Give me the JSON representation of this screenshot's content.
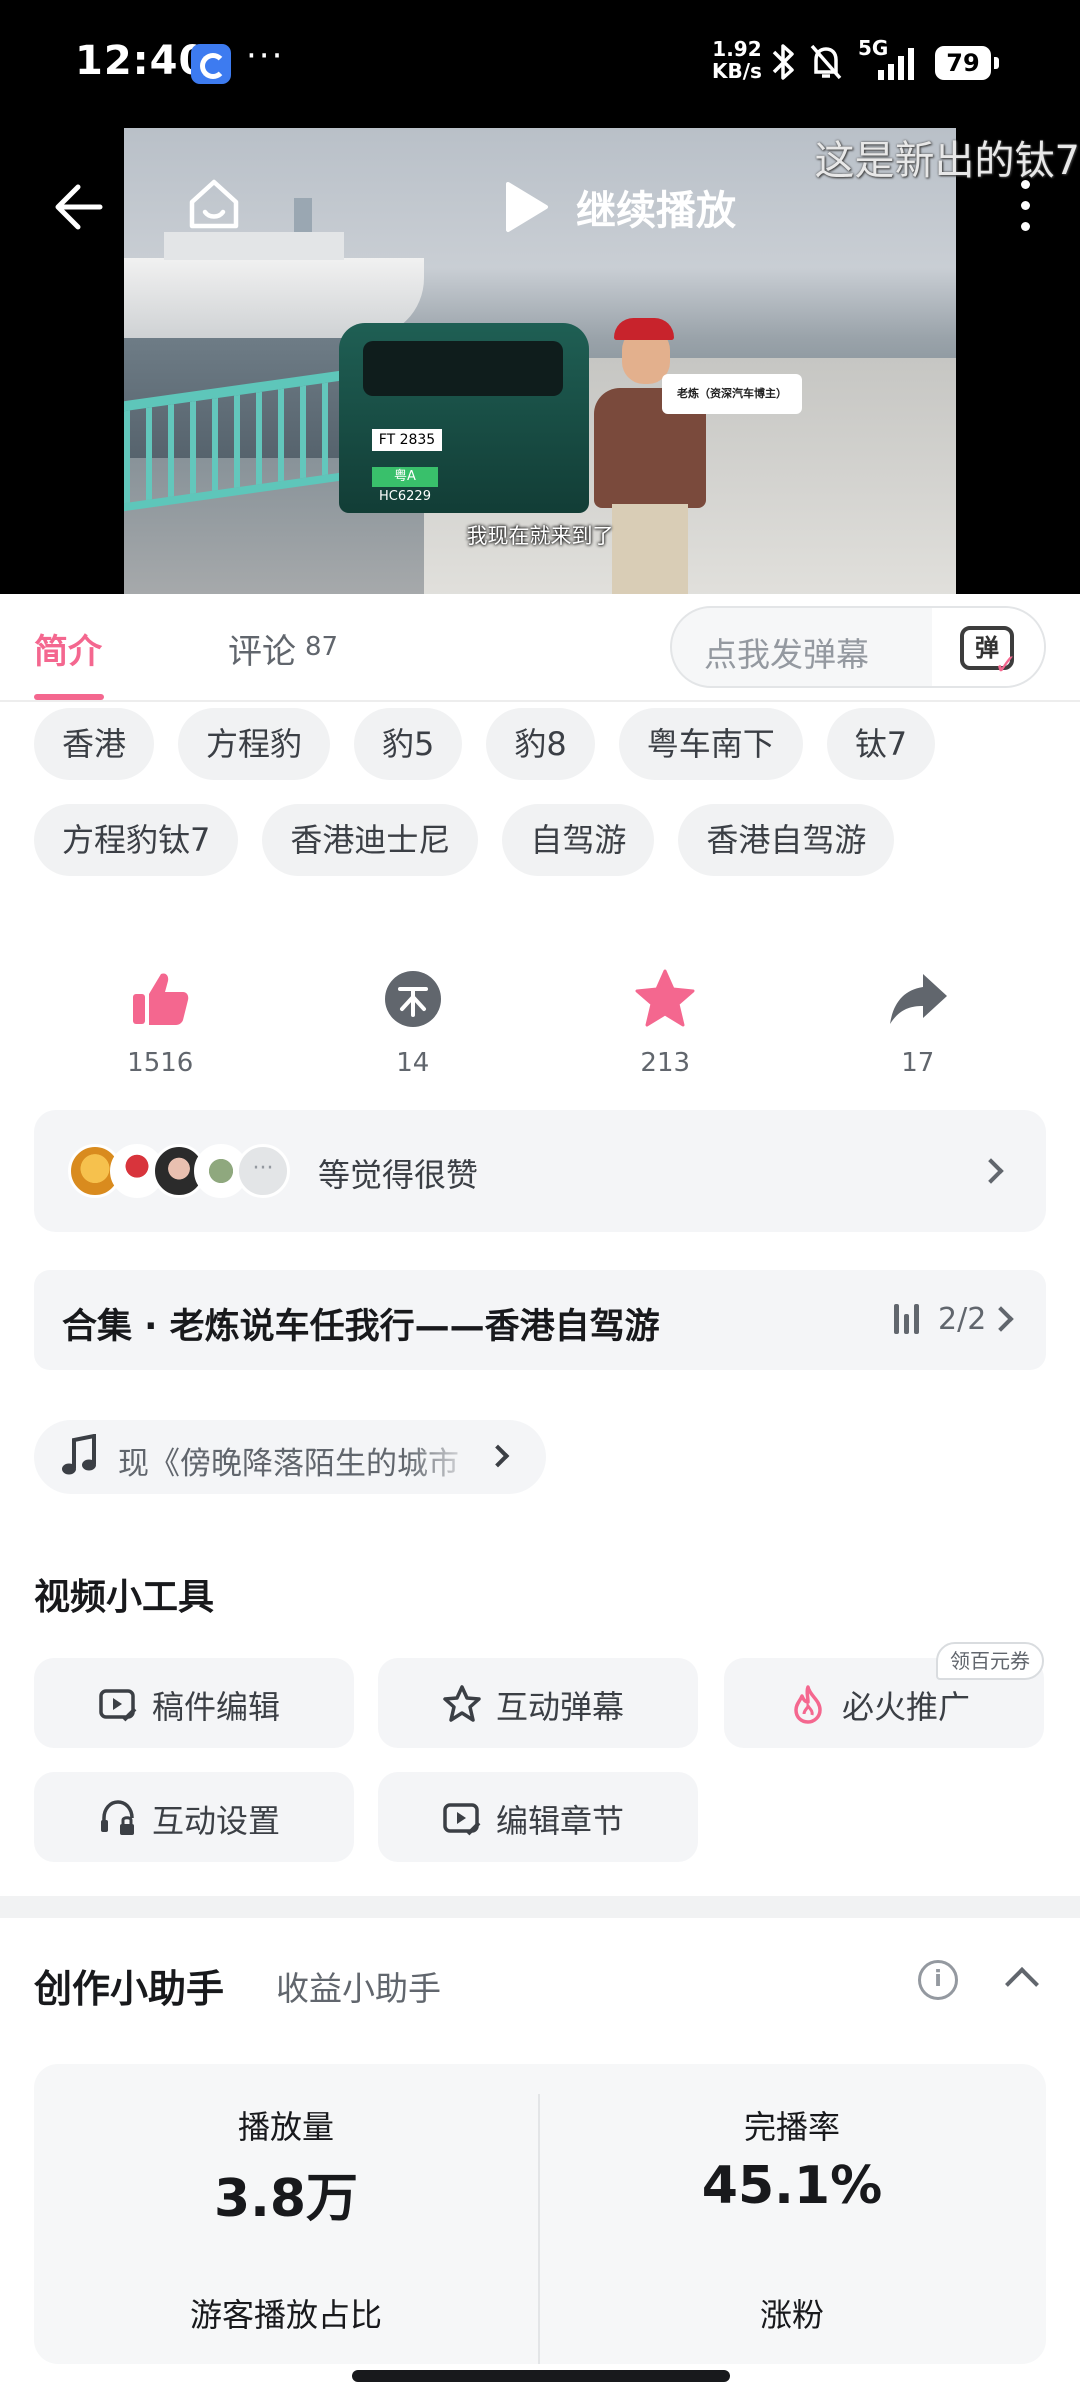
{
  "status_bar": {
    "time": "12:40",
    "more": "···",
    "speed_value": "1.92",
    "speed_unit": "KB/s",
    "network": "5G",
    "battery": "79"
  },
  "video": {
    "resume_label": "继续播放",
    "danmaku": "这是新出的钛7",
    "subtitle": "我现在就来到了",
    "name_card": "老炼（资深汽车博主）",
    "plate_front": "FT 2835",
    "plate_green": "粤A HC6229"
  },
  "tabs": {
    "intro": "简介",
    "comments": "评论",
    "comments_count": "87",
    "danmaku_placeholder": "点我发弹幕",
    "danmaku_button": "弹"
  },
  "tags": [
    "香港",
    "方程豹",
    "豹5",
    "豹8",
    "粤车南下",
    "钛7",
    "方程豹钛7",
    "香港迪士尼",
    "自驾游",
    "香港自驾游"
  ],
  "actions": [
    {
      "icon": "thumbs-up-icon",
      "count": "1516",
      "color": "#f4678f"
    },
    {
      "icon": "coin-icon",
      "count": "14",
      "color": "#61666d"
    },
    {
      "icon": "star-icon",
      "count": "213",
      "color": "#f4678f"
    },
    {
      "icon": "share-icon",
      "count": "17",
      "color": "#61666d"
    }
  ],
  "liked_by": {
    "text": "等觉得很赞",
    "more_dots": "···"
  },
  "collection": {
    "title": "合集 · 老炼说车任我行——香港自驾游",
    "count": "2/2"
  },
  "music": {
    "text": "现《傍晚降落陌生的城市"
  },
  "tools": {
    "title": "视频小工具",
    "items": [
      {
        "label": "稿件编辑",
        "icon": "edit-video-icon"
      },
      {
        "label": "互动弹幕",
        "icon": "interactive-danmaku-icon"
      },
      {
        "label": "必火推广",
        "icon": "fire-icon"
      },
      {
        "label": "互动设置",
        "icon": "interaction-settings-icon"
      },
      {
        "label": "编辑章节",
        "icon": "edit-chapter-icon"
      }
    ],
    "coupon": "领百元券"
  },
  "assistant": {
    "title": "创作小助手",
    "tab2": "收益小助手",
    "info": "i",
    "stats": [
      {
        "label": "播放量",
        "value": "3.8万"
      },
      {
        "label": "完播率",
        "value": "45.1%"
      },
      {
        "label": "游客播放占比",
        "value": ""
      },
      {
        "label": "涨粉",
        "value": ""
      }
    ]
  },
  "colors": {
    "accent": "#f4678f",
    "text_primary": "#18191c",
    "text_secondary": "#61666d",
    "chip_bg": "#f1f2f3"
  }
}
